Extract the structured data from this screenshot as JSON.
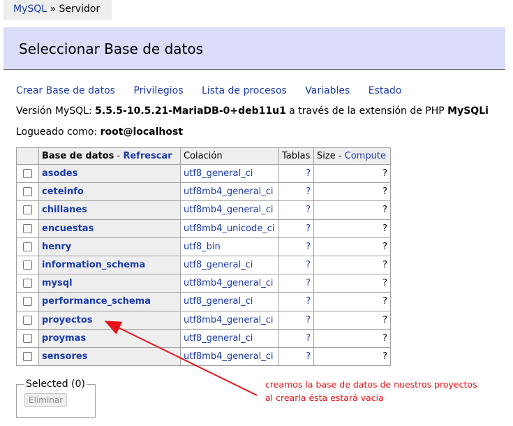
{
  "breadcrumb": {
    "link": "MySQL",
    "separator": " » ",
    "current": "Servidor"
  },
  "header": {
    "title": "Seleccionar Base de datos"
  },
  "links": {
    "create_db": "Crear Base de datos",
    "privileges": "Privilegios",
    "processes": "Lista de procesos",
    "variables": "Variables",
    "status": "Estado"
  },
  "version": {
    "label": "Versión MySQL: ",
    "value": "5.5.5-10.5.21-MariaDB-0+deb11u1",
    "middle": " a través de la extensión de PHP ",
    "extension": "MySQLi"
  },
  "login": {
    "label": "Logueado como: ",
    "user": "root@localhost"
  },
  "table": {
    "headers": {
      "database": "Base de datos",
      "sep": " - ",
      "refresh": "Refrescar",
      "collation": "Colación",
      "tables": "Tablas",
      "size": "Size",
      "size_sep": " - ",
      "compute": "Compute"
    },
    "rows": [
      {
        "name": "asodes",
        "collation": "utf8_general_ci",
        "tables": "?",
        "size": "?"
      },
      {
        "name": "ceteinfo",
        "collation": "utf8mb4_general_ci",
        "tables": "?",
        "size": "?"
      },
      {
        "name": "chillanes",
        "collation": "utf8mb4_general_ci",
        "tables": "?",
        "size": "?"
      },
      {
        "name": "encuestas",
        "collation": "utf8mb4_unicode_ci",
        "tables": "?",
        "size": "?"
      },
      {
        "name": "henry",
        "collation": "utf8_bin",
        "tables": "?",
        "size": "?"
      },
      {
        "name": "information_schema",
        "collation": "utf8_general_ci",
        "tables": "?",
        "size": "?"
      },
      {
        "name": "mysql",
        "collation": "utf8mb4_general_ci",
        "tables": "?",
        "size": "?"
      },
      {
        "name": "performance_schema",
        "collation": "utf8_general_ci",
        "tables": "?",
        "size": "?"
      },
      {
        "name": "proyectos",
        "collation": "utf8mb4_general_ci",
        "tables": "?",
        "size": "?"
      },
      {
        "name": "proymas",
        "collation": "utf8_general_ci",
        "tables": "?",
        "size": "?"
      },
      {
        "name": "sensores",
        "collation": "utf8mb4_general_ci",
        "tables": "?",
        "size": "?"
      }
    ]
  },
  "selected": {
    "legend": "Selected (0)",
    "delete_label": "Eliminar"
  },
  "annotation": {
    "line1": "creamos la base de datos de nuestros proyectos",
    "line2": "al crearla ésta estará vacía",
    "color": "#e8141b"
  },
  "colors": {
    "link": "#1a3aa8",
    "header_bg": "#dcdcfb",
    "cell_bg": "#eeeeee"
  }
}
